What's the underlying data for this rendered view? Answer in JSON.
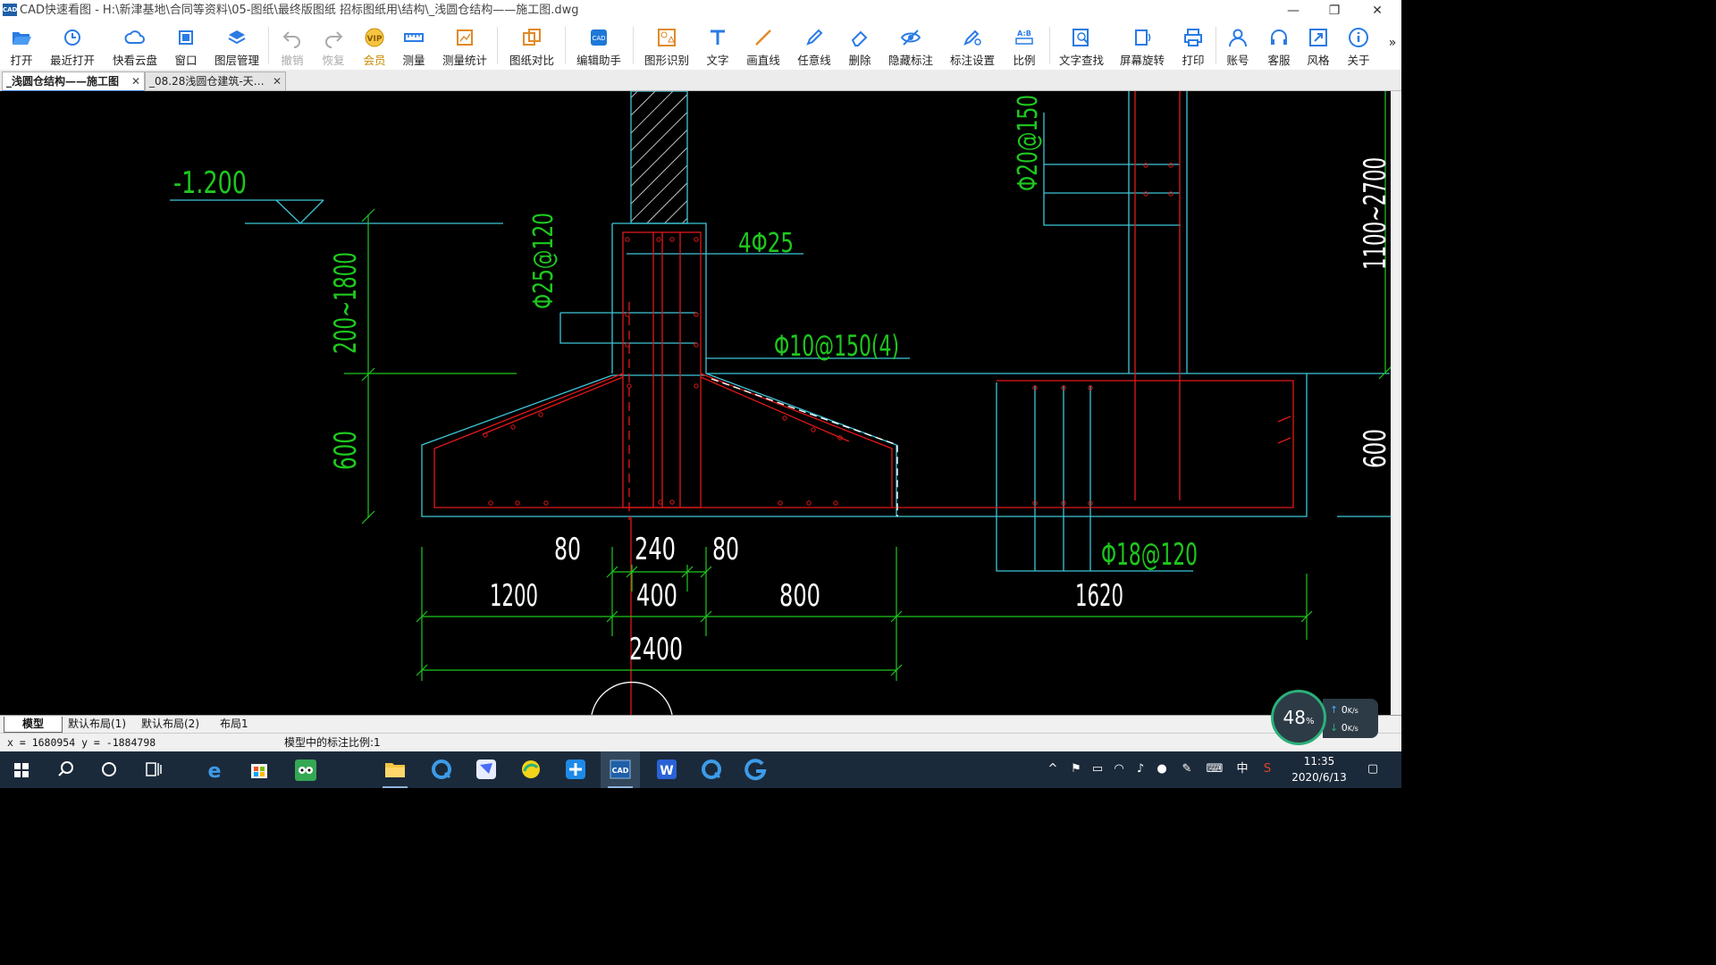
{
  "window": {
    "app_icon": "CAD",
    "title": "CAD快速看图 - H:\\新津基地\\合同等资料\\05-图纸\\最终版图纸 招标图纸用\\结构\\_浅圆仓结构——施工图.dwg",
    "controls": [
      "—",
      "❐",
      "✕"
    ]
  },
  "toolbar": {
    "items": [
      {
        "label": "打开",
        "icon": "folder-open-icon"
      },
      {
        "label": "最近打开",
        "icon": "clock-icon"
      },
      {
        "label": "快看云盘",
        "icon": "cloud-icon"
      },
      {
        "label": "窗口",
        "icon": "window-icon"
      },
      {
        "label": "图层管理",
        "icon": "layers-icon"
      },
      {
        "label": "撤销",
        "icon": "undo-icon"
      },
      {
        "label": "恢复",
        "icon": "redo-icon"
      },
      {
        "label": "会员",
        "icon": "vip-icon"
      },
      {
        "label": "测量",
        "icon": "ruler-icon"
      },
      {
        "label": "测量统计",
        "icon": "measure-stats-icon"
      },
      {
        "label": "图纸对比",
        "icon": "compare-icon"
      },
      {
        "label": "编辑助手",
        "icon": "edit-helper-icon"
      },
      {
        "label": "图形识别",
        "icon": "shape-recognize-icon"
      },
      {
        "label": "文字",
        "icon": "text-icon"
      },
      {
        "label": "画直线",
        "icon": "line-icon"
      },
      {
        "label": "任意线",
        "icon": "pen-icon"
      },
      {
        "label": "删除",
        "icon": "eraser-icon"
      },
      {
        "label": "隐藏标注",
        "icon": "hide-eye-icon"
      },
      {
        "label": "标注设置",
        "icon": "annotation-settings-icon"
      },
      {
        "label": "比例",
        "icon": "scale-icon"
      },
      {
        "label": "文字查找",
        "icon": "text-search-icon"
      },
      {
        "label": "屏幕旋转",
        "icon": "rotate-screen-icon"
      },
      {
        "label": "打印",
        "icon": "printer-icon"
      },
      {
        "label": "账号",
        "icon": "user-icon"
      },
      {
        "label": "客服",
        "icon": "headset-icon"
      },
      {
        "label": "风格",
        "icon": "style-icon"
      },
      {
        "label": "关于",
        "icon": "info-icon"
      }
    ],
    "more": "»"
  },
  "tabs": [
    {
      "label": "_浅圆仓结构——施工图",
      "active": true
    },
    {
      "label": "_08.28浅圆仓建筑-天…",
      "active": false
    }
  ],
  "drawing": {
    "elevation": "-1.200",
    "dim_left_upper": "200~1800",
    "dim_left_lower": "600",
    "dim_right_upper": "1100~2700",
    "dim_right_lower": "600",
    "rebar_4phi25": "4Φ25",
    "rebar_phi25_120": "Φ25@120",
    "rebar_phi10": "Φ10@150(4)",
    "rebar_phi20": "Φ20@150",
    "rebar_phi18": "Φ18@120",
    "dim_80a": "80",
    "dim_240": "240",
    "dim_80b": "80",
    "dim_1200": "1200",
    "dim_400": "400",
    "dim_800": "800",
    "dim_1620": "1620",
    "dim_2400": "2400"
  },
  "layout_tabs": [
    "模型",
    "默认布局(1)",
    "默认布局(2)",
    "布局1"
  ],
  "status": {
    "coords": "x = 1680954  y = -1884798",
    "scale_text": "模型中的标注比例:1"
  },
  "net_widget": {
    "percent": "48",
    "percent_unit": "%",
    "up": "0",
    "down": "0",
    "unit": "K/s"
  },
  "taskbar": {
    "time": "11:35",
    "date": "2020/6/13",
    "ime": "中"
  },
  "colors": {
    "cyan": "#3ec6d8",
    "red": "#e01818",
    "green": "#1ec81e",
    "white": "#ffffff"
  }
}
